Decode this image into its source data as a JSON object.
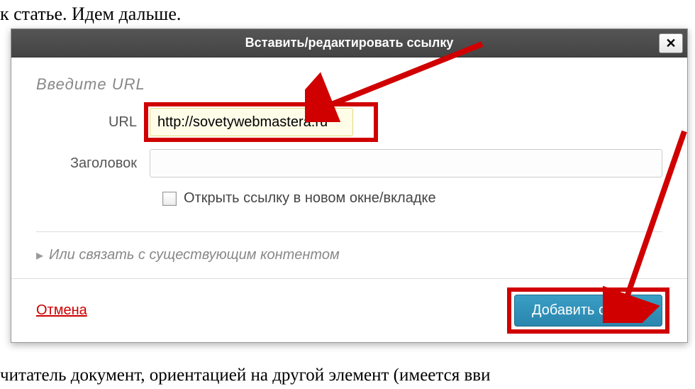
{
  "background": {
    "top_text": "к статье. Идем дальше.",
    "bottom_text": "читатель документ, ориентацией на другой элемент (имеется вви"
  },
  "dialog": {
    "title": "Вставить/редактировать ссылку",
    "close_symbol": "✕",
    "section_heading": "Введите URL",
    "url_label": "URL",
    "url_value": "http://sovetywebmastera.ru",
    "title_label": "Заголовок",
    "title_value": "",
    "checkbox_label": "Открыть ссылку в новом окне/вкладке",
    "expand_label": "Или связать с существующим контентом",
    "expand_arrow": "▸",
    "cancel_label": "Отмена",
    "submit_label": "Добавить ссылку"
  }
}
